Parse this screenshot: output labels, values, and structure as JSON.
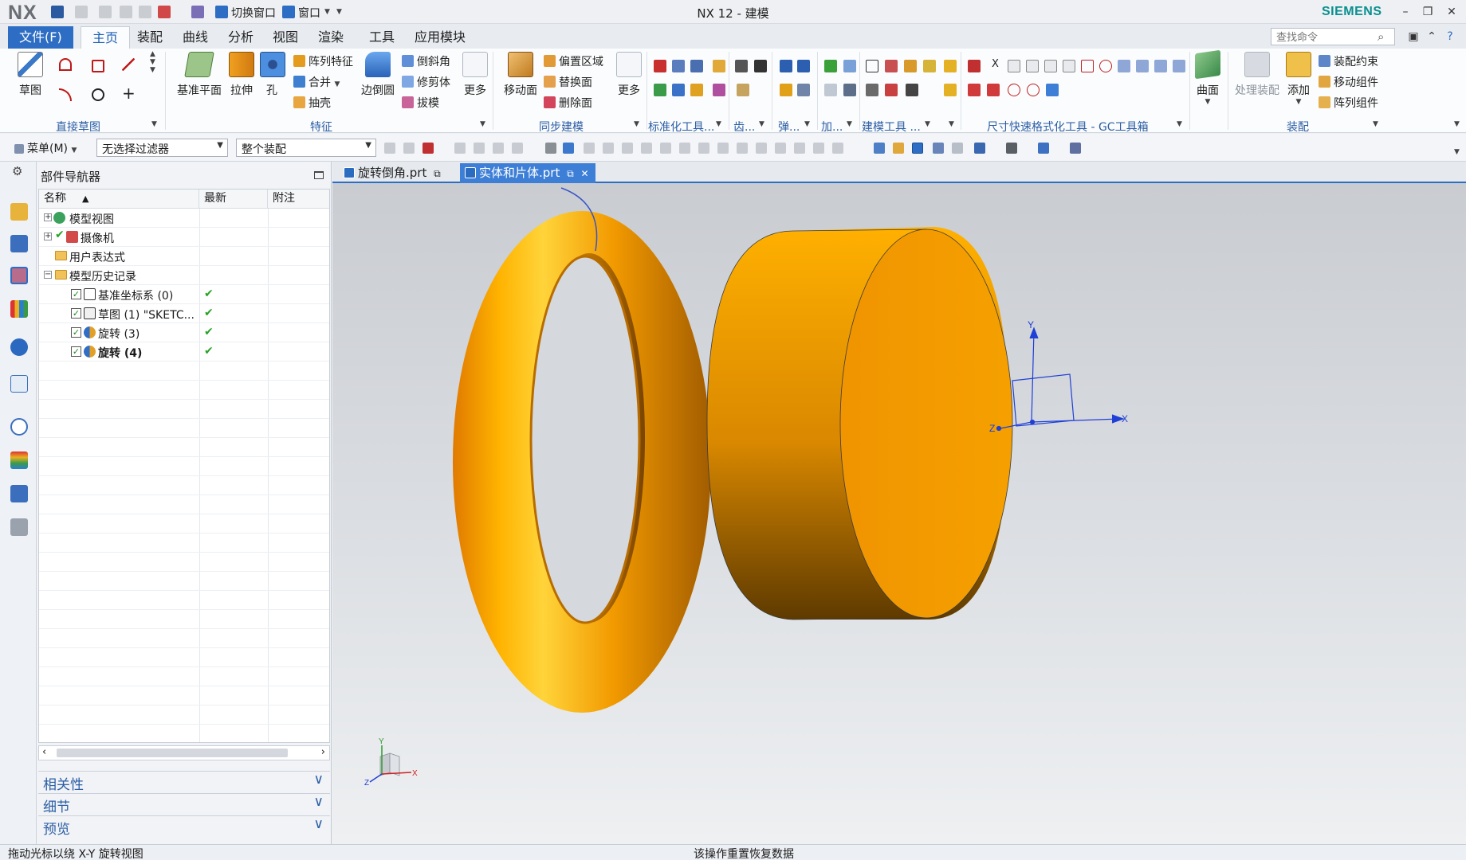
{
  "app": {
    "logo": "NX",
    "title": "NX 12 - 建模",
    "brand": "SIEMENS",
    "quick_access": {
      "switch_window": "切换窗口",
      "window_menu": "窗口"
    },
    "colors": {
      "accent": "#2d6dc4",
      "brand": "#0a8f8f",
      "model": "#f5a000"
    }
  },
  "ribbon": {
    "tabs": [
      "文件(F)",
      "主页",
      "装配",
      "曲线",
      "分析",
      "视图",
      "渲染",
      "工具",
      "应用模块"
    ],
    "active_tab": "主页",
    "search_placeholder": "查找命令",
    "groups": {
      "sketch": {
        "label": "直接草图",
        "sketch_btn": "草图"
      },
      "feature": {
        "label": "特征",
        "datum_plane": "基准平面",
        "extrude": "拉伸",
        "hole": "孔",
        "pattern_feature": "阵列特征",
        "unite": "合并",
        "shell": "抽壳",
        "edge_blend": "边倒圆",
        "chamfer": "倒斜角",
        "trim_body": "修剪体",
        "draft": "拔模",
        "more": "更多"
      },
      "sync": {
        "label": "同步建模",
        "move_face": "移动面",
        "offset_region": "偏置区域",
        "replace_face": "替换面",
        "delete_face": "删除面",
        "more": "更多"
      },
      "std_tools": {
        "label": "标准化工具..."
      },
      "gear": {
        "label": "齿..."
      },
      "spring": {
        "label": "弹..."
      },
      "add": {
        "label": "加..."
      },
      "model_tools": {
        "label": "建模工具 ..."
      },
      "dim_tools": {
        "label": "尺寸快速格式化工具 - GC工具箱"
      },
      "surface": {
        "label": "曲面"
      },
      "assembly": {
        "label": "装配",
        "process_assembly": "处理装配",
        "add": "添加",
        "constraint": "装配约束",
        "move_component": "移动组件",
        "pattern_component": "阵列组件"
      }
    }
  },
  "selection_bar": {
    "menu": "菜单(M)",
    "filter": "无选择过滤器",
    "scope": "整个装配"
  },
  "navigator": {
    "title": "部件导航器",
    "columns": [
      "名称",
      "最新",
      "附注"
    ],
    "rows": [
      {
        "label": "模型视图",
        "expander": "+",
        "latest": false
      },
      {
        "label": "摄像机",
        "expander": "+",
        "latest": false
      },
      {
        "label": "用户表达式",
        "expander": "",
        "latest": false
      },
      {
        "label": "模型历史记录",
        "expander": "−",
        "latest": false
      },
      {
        "label": "基准坐标系 (0)",
        "checked": true,
        "latest": true
      },
      {
        "label": "草图 (1) \"SKETC...",
        "checked": true,
        "latest": true
      },
      {
        "label": "旋转 (3)",
        "checked": true,
        "latest": true
      },
      {
        "label": "旋转 (4)",
        "checked": true,
        "latest": true,
        "bold": true
      }
    ],
    "panels": [
      "相关性",
      "细节",
      "预览"
    ]
  },
  "documents": {
    "tabs": [
      {
        "label": "旋转倒角.prt",
        "active": false
      },
      {
        "label": "实体和片体.prt",
        "active": true
      }
    ]
  },
  "viewport": {
    "axes": {
      "x": "X",
      "y": "Y",
      "z": "Z"
    }
  },
  "status": {
    "left": "拖动光标以绕 X-Y 旋转视图",
    "center": "该操作重置恢复数据"
  }
}
